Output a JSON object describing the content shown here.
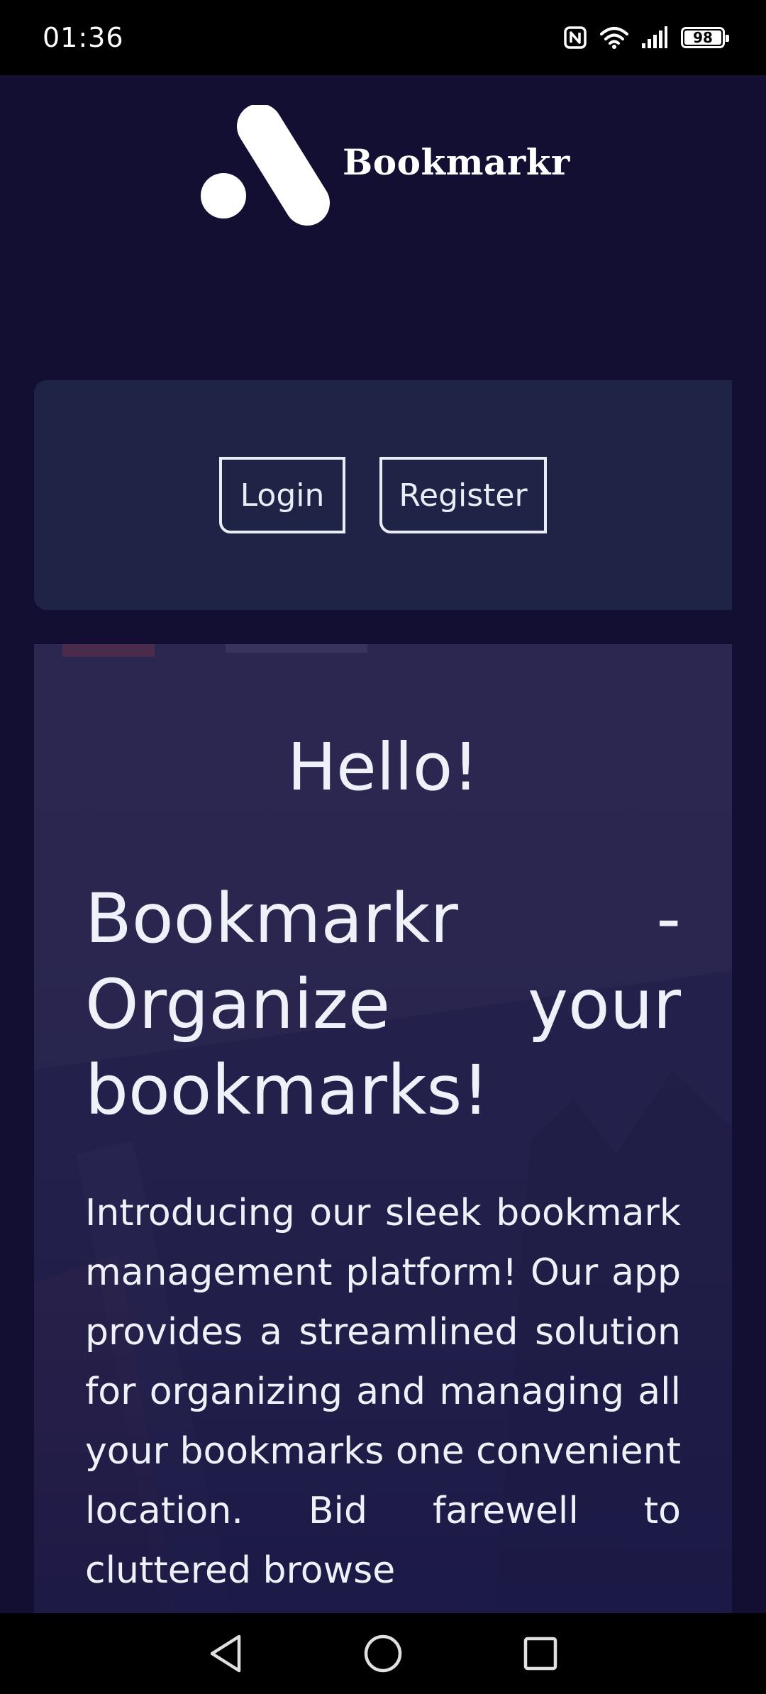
{
  "status_bar": {
    "time": "01:36",
    "battery_level": "98",
    "icons": [
      "nfc-icon",
      "wifi-icon",
      "signal-icon",
      "battery-icon"
    ]
  },
  "header": {
    "brand_name": "Bookmarkr",
    "logo": "bookmarkr-logo"
  },
  "auth": {
    "login_label": "Login",
    "register_label": "Register"
  },
  "hero": {
    "greeting": "Hello!",
    "title": "Bookmarkr - Organize your bookmarks!",
    "body": "Introducing our sleek bookmark management platform! Our app provides a streamlined solution for organizing and managing all your bookmarks one convenient location. Bid farewell to cluttered browse"
  },
  "nav_bar": {
    "back": "back-icon",
    "home": "home-icon",
    "recents": "recents-icon"
  },
  "colors": {
    "page_background": "#120f33",
    "panel_background": "#1f2447",
    "hero_background": "#2b2750",
    "text": "#eef2f8"
  }
}
